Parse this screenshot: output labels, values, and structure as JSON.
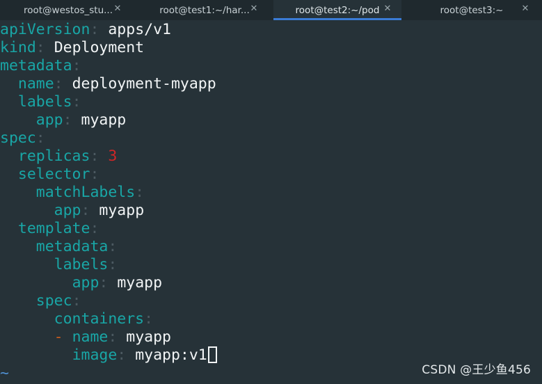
{
  "tabs": [
    {
      "label": "root@westos_stu...",
      "close": "✕",
      "active": false
    },
    {
      "label": "root@test1:~/har...",
      "close": "✕",
      "active": false
    },
    {
      "label": "root@test2:~/pod",
      "close": "✕",
      "active": true
    },
    {
      "label": "root@test3:~",
      "close": "✕",
      "active": false
    }
  ],
  "editor": {
    "lines": [
      {
        "indent": "",
        "key": "apiVersion",
        "value": "apps/v1"
      },
      {
        "indent": "",
        "key": "kind",
        "value": "Deployment"
      },
      {
        "indent": "",
        "key": "metadata",
        "value": ""
      },
      {
        "indent": "  ",
        "key": "name",
        "value": "deployment-myapp"
      },
      {
        "indent": "  ",
        "key": "labels",
        "value": ""
      },
      {
        "indent": "    ",
        "key": "app",
        "value": "myapp"
      },
      {
        "indent": "",
        "key": "spec",
        "value": ""
      },
      {
        "indent": "  ",
        "key": "replicas",
        "value": "3"
      },
      {
        "indent": "  ",
        "key": "selector",
        "value": ""
      },
      {
        "indent": "    ",
        "key": "matchLabels",
        "value": ""
      },
      {
        "indent": "      ",
        "key": "app",
        "value": "myapp"
      },
      {
        "indent": "  ",
        "key": "template",
        "value": ""
      },
      {
        "indent": "    ",
        "key": "metadata",
        "value": ""
      },
      {
        "indent": "      ",
        "key": "labels",
        "value": ""
      },
      {
        "indent": "        ",
        "key": "app",
        "value": "myapp"
      },
      {
        "indent": "    ",
        "key": "spec",
        "value": ""
      },
      {
        "indent": "      ",
        "key": "containers",
        "value": ""
      },
      {
        "indent": "      ",
        "dash": "- ",
        "key": "name",
        "value": "myapp"
      },
      {
        "indent": "        ",
        "key": "image",
        "value": "myapp:v1"
      }
    ],
    "empty_line_marker": "~"
  },
  "watermark": "CSDN @王少鱼456",
  "colors": {
    "background": "#263238",
    "tabbar": "#1f292e",
    "key": "#19a6a6",
    "value": "#f2f5f6",
    "number": "#d02626",
    "dash": "#c85c1e",
    "active_tab_underline": "#3a7bd5"
  }
}
